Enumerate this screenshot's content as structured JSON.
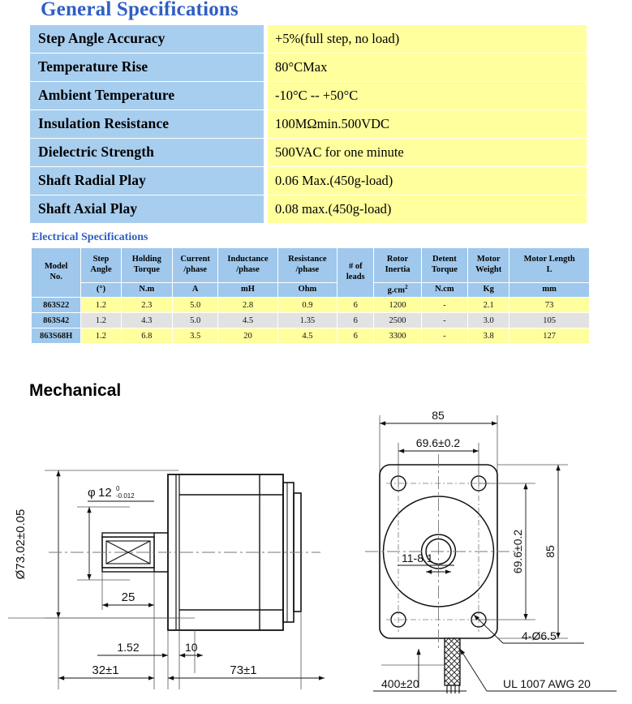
{
  "general": {
    "title": "General Specifications",
    "rows": [
      {
        "label": "Step Angle Accuracy",
        "value": "+5%(full step, no load)"
      },
      {
        "label": "Temperature Rise",
        "value": "80°CMax"
      },
      {
        "label": "Ambient Temperature",
        "value": "-10°C -- +50°C"
      },
      {
        "label": "Insulation Resistance",
        "value": "100MΩmin.500VDC"
      },
      {
        "label": "Dielectric Strength",
        "value": "500VAC for one minute"
      },
      {
        "label": "Shaft Radial Play",
        "value": "0.06 Max.(450g-load)"
      },
      {
        "label": "Shaft Axial Play",
        "value": "0.08 max.(450g-load)"
      }
    ]
  },
  "electrical": {
    "title": "Electrical Specifications",
    "columns": [
      {
        "name": "Model No.",
        "unit": ""
      },
      {
        "name": "Step Angle",
        "unit": "(°)"
      },
      {
        "name": "Holding Torque",
        "unit": "N.m"
      },
      {
        "name": "Current /phase",
        "unit": "A"
      },
      {
        "name": "Inductance /phase",
        "unit": "mH"
      },
      {
        "name": "Resistance /phase",
        "unit": "Ohm"
      },
      {
        "name": "# of leads",
        "unit": ""
      },
      {
        "name": "Rotor Inertia",
        "unit": "g.cm2"
      },
      {
        "name": "Detent Torque",
        "unit": "N.cm"
      },
      {
        "name": "Motor Weight",
        "unit": "Kg"
      },
      {
        "name": "Motor Length L",
        "unit": "mm"
      }
    ],
    "header_lines": {
      "model_l1": "Model",
      "model_l2": "No.",
      "step_l1": "Step",
      "step_l2": "Angle",
      "step_unit": "(°)",
      "holding_l1": "Holding",
      "holding_l2": "Torque",
      "holding_unit": "N.m",
      "current_l1": "Current",
      "current_l2": "/phase",
      "current_unit": "A",
      "induct_l1": "Inductance",
      "induct_l2": "/phase",
      "induct_unit": "mH",
      "resist_l1": "Resistance",
      "resist_l2": "/phase",
      "resist_unit": "Ohm",
      "leads_l1": "# of",
      "leads_l2": "leads",
      "rotor_l1": "Rotor",
      "rotor_l2": "Inertia",
      "rotor_unit": "g.cm",
      "rotor_unit_sup": "2",
      "detent_l1": "Detent",
      "detent_l2": "Torque",
      "detent_unit": "N.cm",
      "weight_l1": "Motor",
      "weight_l2": "Weight",
      "weight_unit": "Kg",
      "length_l1": "Motor Length",
      "length_l2": "L",
      "length_unit": "mm"
    },
    "rows": [
      {
        "model": "863S22",
        "step_angle": "1.2",
        "holding_torque": "2.3",
        "current": "5.0",
        "inductance": "2.8",
        "resistance": "0.9",
        "leads": "6",
        "rotor_inertia": "1200",
        "detent_torque": "-",
        "weight": "2.1",
        "length": "73"
      },
      {
        "model": "863S42",
        "step_angle": "1.2",
        "holding_torque": "4.3",
        "current": "5.0",
        "inductance": "4.5",
        "resistance": "1.35",
        "leads": "6",
        "rotor_inertia": "2500",
        "detent_torque": "-",
        "weight": "3.0",
        "length": "105"
      },
      {
        "model": "863S68H",
        "step_angle": "1.2",
        "holding_torque": "6.8",
        "current": "3.5",
        "inductance": "20",
        "resistance": "4.5",
        "leads": "6",
        "rotor_inertia": "3300",
        "detent_torque": "-",
        "weight": "3.8",
        "length": "127"
      }
    ]
  },
  "mechanical": {
    "title": "Mechanical",
    "side_view": {
      "shaft_diameter": "12",
      "shaft_tol_upper": "0",
      "shaft_tol_lower": "-0.012",
      "shaft_dia_symbol": "φ",
      "flange_diameter": "Ø73.02±0.05",
      "dim_25": "25",
      "dim_152": "1.52",
      "dim_10": "10",
      "dim_32": "32±1",
      "dim_73": "73±1"
    },
    "front_view": {
      "dim_85_top": "85",
      "dim_696_top": "69.6±0.2",
      "dim_696_right": "69.6±0.2",
      "dim_85_right": "85",
      "boss_callout": "11-8.1",
      "boss_tol_upper": "0",
      "boss_tol_lower": ".1",
      "hole_callout": "4-Ø6.5",
      "wire_length": "400±20",
      "wire_spec": "UL 1007 AWG 20"
    }
  },
  "colors": {
    "title_blue": "#2f5fc4",
    "label_blue": "#a8ceef",
    "value_yellow": "#ffff9e",
    "band_gray": "#e2e2e2",
    "header_blue": "#9fc8ec"
  }
}
